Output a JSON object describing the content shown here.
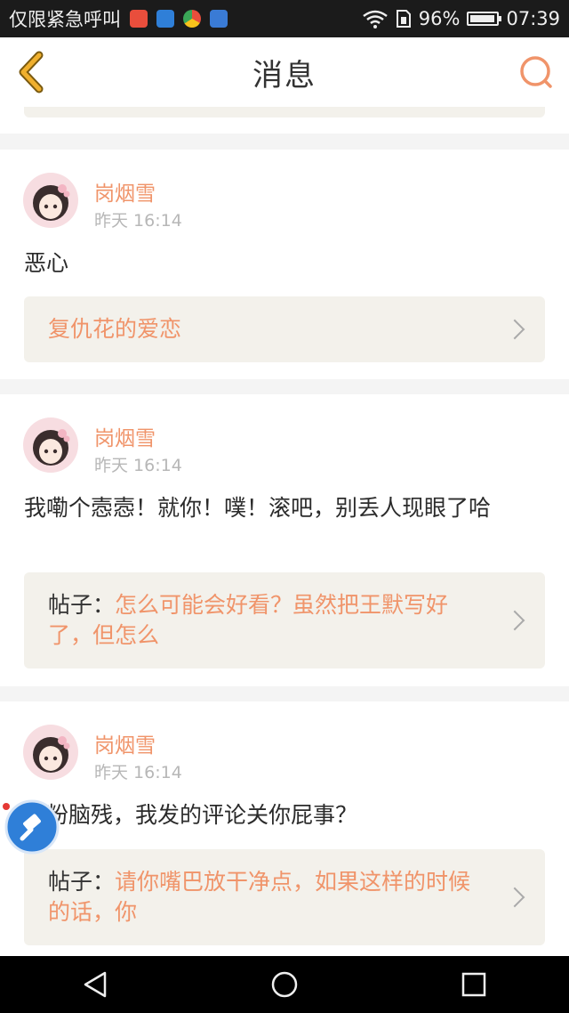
{
  "status_bar": {
    "carrier": "仅限紧急呼叫",
    "battery": "96%",
    "battery_level": 0.96,
    "time": "07:39",
    "app_icons": [
      "weibo-icon",
      "signal-app-icon",
      "chrome-icon",
      "shield-app-icon"
    ]
  },
  "header": {
    "title": "消息"
  },
  "colors": {
    "accent": "#f0946a",
    "username": "#f0946a",
    "ref_bg": "#f3f1eb",
    "icon_gold": "#f0b02e"
  },
  "messages": [
    {
      "user": "岗烟雪",
      "time": "昨天 16:14",
      "text": "恶心",
      "ref_prefix": "",
      "ref_text": "复仇花的爱恋"
    },
    {
      "user": "岗烟雪",
      "time": "昨天 16:14",
      "text": "我嘞个悫悫！就你！噗！滚吧，别丢人现眼了哈",
      "ref_prefix": "帖子：",
      "ref_text": "怎么可能会好看？虽然把王默写好了，但怎么"
    },
    {
      "user": "岗烟雪",
      "time": "昨天 16:14",
      "text": "男粉脑残，我发的评论关你屁事？",
      "ref_prefix": "帖子：",
      "ref_text": "请你嘴巴放干净点，如果这样的时候的话，你"
    }
  ]
}
